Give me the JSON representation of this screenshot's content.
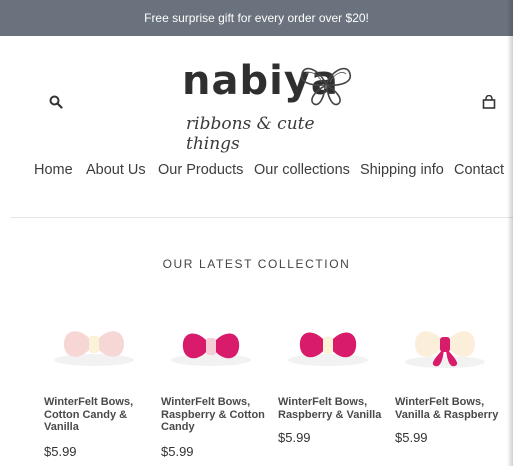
{
  "announcement": "Free surprise gift for every order over $20!",
  "header": {
    "logo_word": "nabiya",
    "logo_tagline": "ribbons & cute things",
    "search_icon": "search-icon",
    "cart_icon": "shopping-bag-icon"
  },
  "nav": {
    "items": [
      "Home",
      "About Us",
      "Our Products",
      "Our collections",
      "Shipping info",
      "Contact"
    ]
  },
  "section": {
    "title": "OUR LATEST COLLECTION"
  },
  "products": [
    {
      "name": "WinterFelt Bows, Cotton Candy & Vanilla",
      "price": "$5.99"
    },
    {
      "name": "WinterFelt Bows, Raspberry & Cotton Candy",
      "price": "$5.99"
    },
    {
      "name": "WinterFelt Bows, Raspberry & Vanilla",
      "price": "$5.99"
    },
    {
      "name": "WinterFelt Bows, Vanilla & Raspberry",
      "price": "$5.99"
    }
  ],
  "colors": {
    "announcement_bg": "#69727d",
    "raspberry": "#d81b6a",
    "cotton_candy": "#f7d6d8",
    "vanilla": "#fbf3dc"
  }
}
